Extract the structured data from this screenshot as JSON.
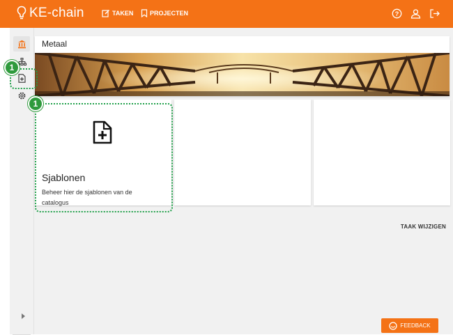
{
  "app": {
    "brand": "KE-chain",
    "nav": {
      "tasks_label": "TAKEN",
      "projects_label": "PROJECTEN"
    },
    "top_icons": [
      "help-icon",
      "user-icon",
      "logout-icon"
    ]
  },
  "sidebar": {
    "items": [
      {
        "icon": "bank-icon",
        "active": true
      },
      {
        "icon": "sitemap-icon"
      },
      {
        "icon": "file-plus-icon"
      },
      {
        "icon": "gear-icon"
      }
    ],
    "expand_icon": "caret-right-icon"
  },
  "header": {
    "title": "Metaal",
    "banner": "bridge-image"
  },
  "tiles": [
    {
      "title": "Sjablonen",
      "description": "Beheer hier de sjablonen van de catalogus",
      "icon": "file-plus-icon"
    },
    {
      "title": "",
      "description": ""
    },
    {
      "title": "",
      "description": ""
    }
  ],
  "actions": {
    "edit_task": "TAAK WIJZIGEN",
    "feedback": "FEEDBACK"
  },
  "callouts": [
    {
      "number": "1"
    },
    {
      "number": "1"
    }
  ],
  "colors": {
    "accent": "#f47216",
    "callout": "#2e9a3c"
  }
}
